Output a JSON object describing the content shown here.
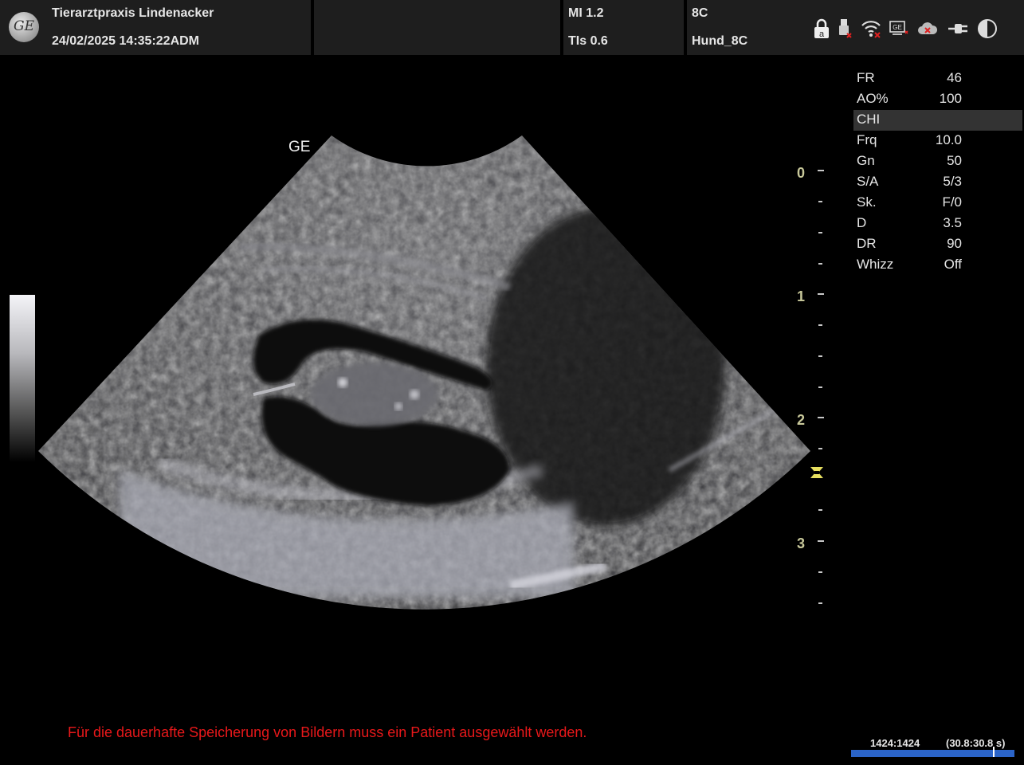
{
  "header": {
    "institution": "Tierarztpraxis Lindenacker",
    "datetime": "24/02/2025 14:35:22ADM",
    "mi": "MI 1.2",
    "tis": "TIs 0.6",
    "probe": "8C",
    "preset": "Hund_8C",
    "logo_text": "GE",
    "status_icons": [
      "lock-icon",
      "usb-icon",
      "wifi-icon",
      "ge-connect-icon",
      "cloud-icon",
      "power-plug-icon",
      "contrast-icon"
    ]
  },
  "image": {
    "ge_mark": "GE"
  },
  "depth_scale": {
    "labels": [
      "0",
      "1",
      "2",
      "3"
    ],
    "unit": "cm",
    "max_depth": 3.5,
    "focus_depth": 2.45
  },
  "params": [
    {
      "key": "FR",
      "value": "46"
    },
    {
      "key": "AO%",
      "value": "100"
    },
    {
      "key": "CHI",
      "value": ""
    },
    {
      "key": "Frq",
      "value": "10.0"
    },
    {
      "key": "Gn",
      "value": "50"
    },
    {
      "key": "S/A",
      "value": "5/3"
    },
    {
      "key": "Sk.",
      "value": "F/0"
    },
    {
      "key": "D",
      "value": "3.5"
    },
    {
      "key": "DR",
      "value": "90"
    },
    {
      "key": "Whizz",
      "value": "Off"
    }
  ],
  "message": "Für die dauerhafte Speicherung von Bildern muss ein Patient ausgewählt werden.",
  "cine": {
    "frames": "1424:1424",
    "time": "(30.8:30.8 s)",
    "progress": 1.0
  },
  "colors": {
    "panel": "#1e1e1e",
    "depth_label": "#c8c89a",
    "focus_marker": "#e8e060",
    "message": "#e8181a",
    "cine_bar": "#2b64c8"
  }
}
